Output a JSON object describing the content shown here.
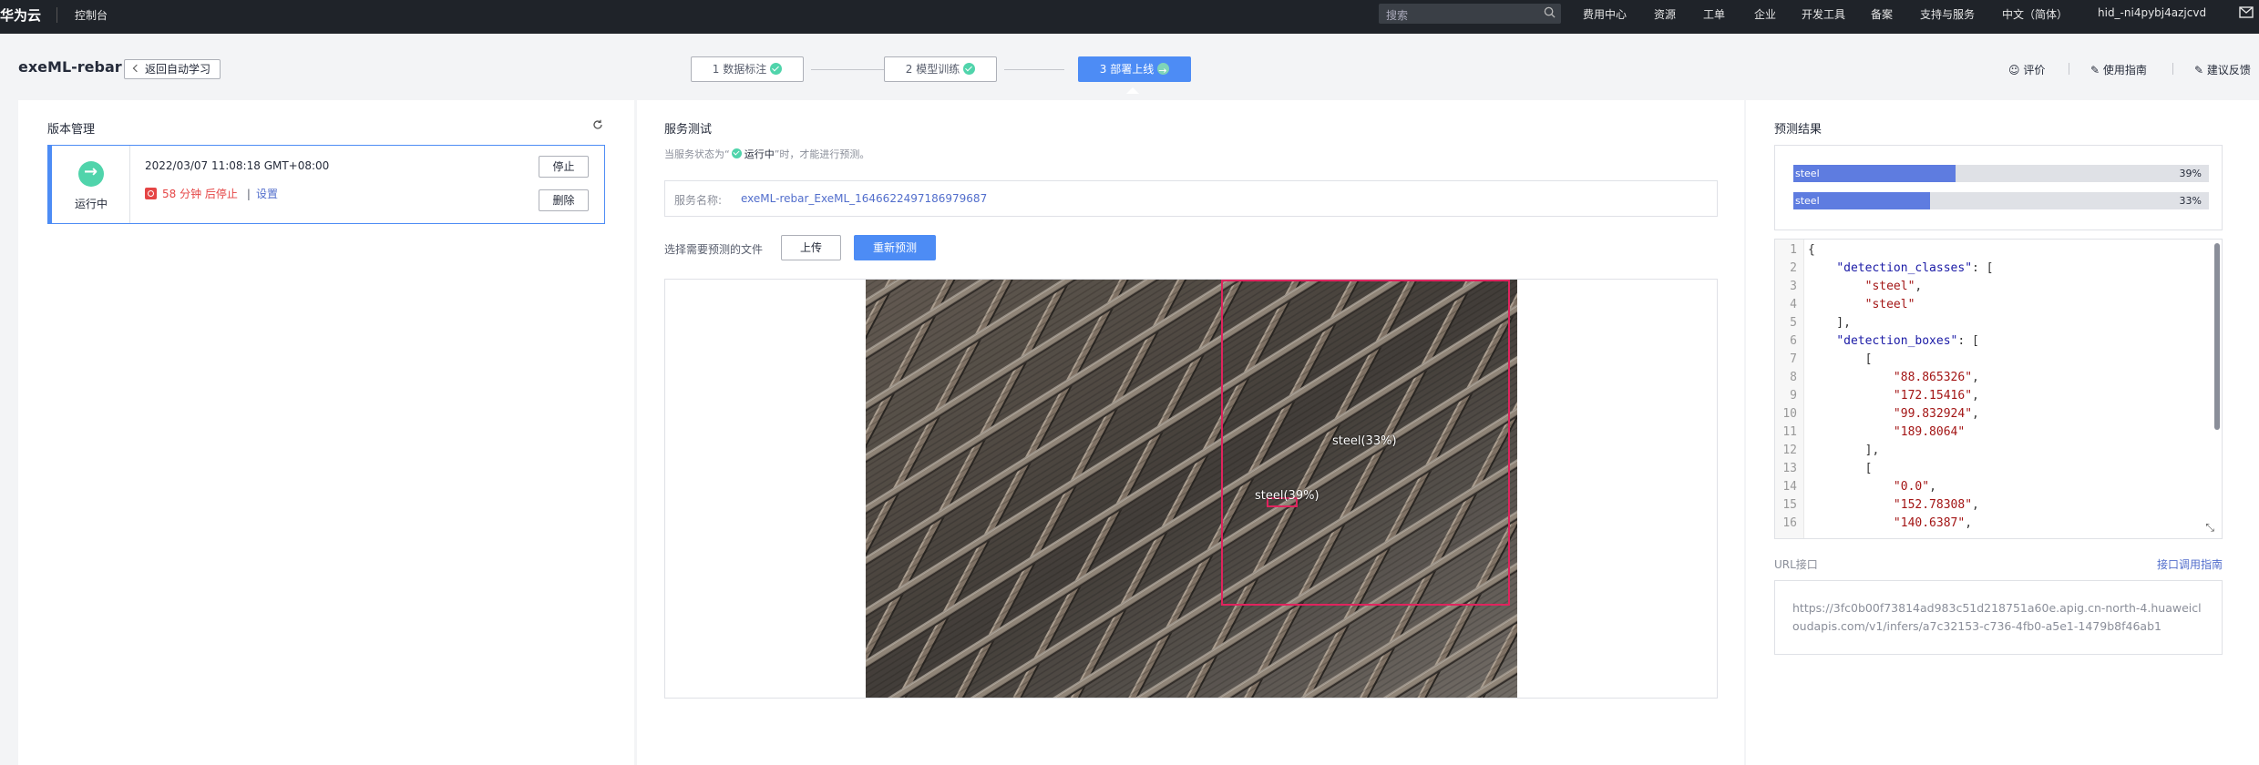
{
  "topbar": {
    "brand": "华为云",
    "console": "控制台",
    "search_placeholder": "搜索",
    "nav": [
      "费用中心",
      "资源",
      "工单",
      "企业",
      "开发工具",
      "备案",
      "支持与服务",
      "中文（简体）"
    ],
    "username": "hid_-ni4pybj4azjcvd"
  },
  "header": {
    "project_title": "exeML-rebar",
    "back_label": "返回自动学习",
    "steps": [
      "1 数据标注",
      "2 模型训练",
      "3 部署上线"
    ],
    "links": [
      "评价",
      "使用指南",
      "建议反馈"
    ]
  },
  "version": {
    "title": "版本管理",
    "status": "运行中",
    "datetime": "2022/03/07 11:08:18 GMT+08:00",
    "stop_warning": "58 分钟 后停止",
    "settings_label": "设置",
    "stop_btn": "停止",
    "delete_btn": "删除"
  },
  "service": {
    "title": "服务测试",
    "hint_prefix": "当服务状态为“",
    "hint_status": "运行中",
    "hint_suffix": "”时，才能进行预测。",
    "name_label": "服务名称:",
    "name_value": "exeML-rebar_ExeML_1646622497186979687",
    "file_label": "选择需要预测的文件",
    "upload_btn": "上传",
    "repredict_btn": "重新预测",
    "detections": [
      {
        "label": "steel(33%)"
      },
      {
        "label": "steel(39%)"
      }
    ]
  },
  "prediction": {
    "title": "预测结果",
    "results": [
      {
        "label": "steel",
        "pct": "39%",
        "fraction": 0.39
      },
      {
        "label": "steel",
        "pct": "33%",
        "fraction": 0.33
      }
    ],
    "json_lines": [
      "{",
      "    \"detection_classes\": [",
      "        \"steel\",",
      "        \"steel\"",
      "    ],",
      "    \"detection_boxes\": [",
      "        [",
      "            \"88.865326\",",
      "            \"172.15416\",",
      "            \"99.832924\",",
      "            \"189.8064\"",
      "        ],",
      "        [",
      "            \"0.0\",",
      "            \"152.78308\",",
      "            \"140.6387\","
    ],
    "url_label": "URL接口",
    "url_guide": "接口调用指南",
    "url_value": "https://3fc0b00f73814ad983c51d218751a60e.apig.cn-north-4.huaweicloudapis.com/v1/infers/a7c32153-c736-4fb0-a5e1-1479b8f46ab1"
  },
  "colors": {
    "primary": "#4d8cf5",
    "success": "#50d4ab",
    "danger": "#e54545",
    "bbox": "#e0245e"
  }
}
